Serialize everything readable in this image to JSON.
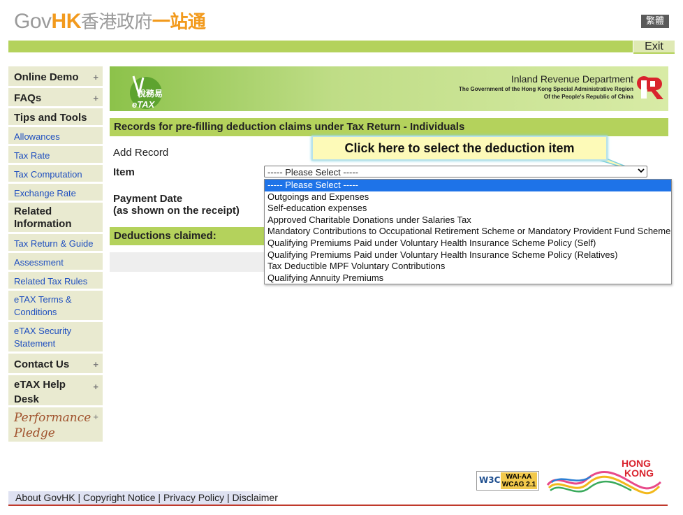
{
  "header": {
    "logo_gov": "Gov",
    "logo_hk": "HK",
    "logo_cn1": "香港政府",
    "logo_cn2": "一站通",
    "lang_button": "繁體",
    "exit_button": "Exit"
  },
  "sidebar": {
    "items": [
      {
        "label": "Online Demo",
        "type": "head",
        "plus": true
      },
      {
        "label": "FAQs",
        "type": "head",
        "plus": true
      },
      {
        "label": "Tips and Tools",
        "type": "head",
        "plus": false
      },
      {
        "label": "Allowances",
        "type": "link"
      },
      {
        "label": "Tax Rate",
        "type": "link"
      },
      {
        "label": "Tax Computation",
        "type": "link"
      },
      {
        "label": "Exchange Rate",
        "type": "link"
      },
      {
        "label": "Related Information",
        "type": "head",
        "plus": false
      },
      {
        "label": "Tax Return & Guide",
        "type": "link"
      },
      {
        "label": "Assessment",
        "type": "link"
      },
      {
        "label": "Related Tax Rules",
        "type": "link"
      },
      {
        "label": "eTAX Terms & Conditions",
        "type": "link"
      },
      {
        "label": "eTAX Security Statement",
        "type": "link"
      },
      {
        "label": "Contact Us",
        "type": "head",
        "plus": true
      },
      {
        "label": "eTAX Help Desk",
        "type": "head",
        "plus": true
      }
    ],
    "performance_pledge": "Performance Pledge",
    "plus_glyph": "+"
  },
  "banner": {
    "etax_cn": "稅務易",
    "etax": "eTAX",
    "ird_title": "Inland Revenue Department",
    "ird_sub1": "The Government of the Hong Kong Special Administrative Region",
    "ird_sub2": "Of the People's Republic of China"
  },
  "main": {
    "section_title": "Records for pre-filling deduction claims under Tax Return - Individuals",
    "add_record": "Add Record",
    "item_label": "Item",
    "payment_date_label": "Payment Date",
    "payment_date_sub": "(as shown on the receipt)",
    "deductions_claimed": "Deductions claimed:"
  },
  "select": {
    "value": "----- Please Select -----",
    "options": [
      "----- Please Select -----",
      "Outgoings and Expenses",
      "Self-education expenses",
      "Approved Charitable Donations under Salaries Tax",
      "Mandatory Contributions to Occupational Retirement Scheme or Mandatory Provident Fund Scheme",
      "Qualifying Premiums Paid under Voluntary Health Insurance Scheme Policy (Self)",
      "Qualifying Premiums Paid under Voluntary Health Insurance Scheme Policy (Relatives)",
      "Tax Deductible MPF Voluntary Contributions",
      "Qualifying Annuity Premiums"
    ],
    "selected_index": 0
  },
  "tooltip": {
    "text": "Click here to select the deduction item"
  },
  "footer": {
    "links": [
      "About GovHK",
      "Copyright Notice",
      "Privacy Policy",
      "Disclaimer"
    ],
    "separator": "|",
    "w3c": "W3C",
    "wai": "WAI-AA",
    "wcag": "WCAG 2.1",
    "brand_line1": "HONG",
    "brand_line2": "KONG"
  },
  "colors": {
    "green": "#b4d25c",
    "sidebar_bg": "#e9ead0",
    "link": "#1f4fbf",
    "orange": "#f29a1d",
    "selected": "#1e73e8",
    "ird_red": "#d9232d"
  }
}
